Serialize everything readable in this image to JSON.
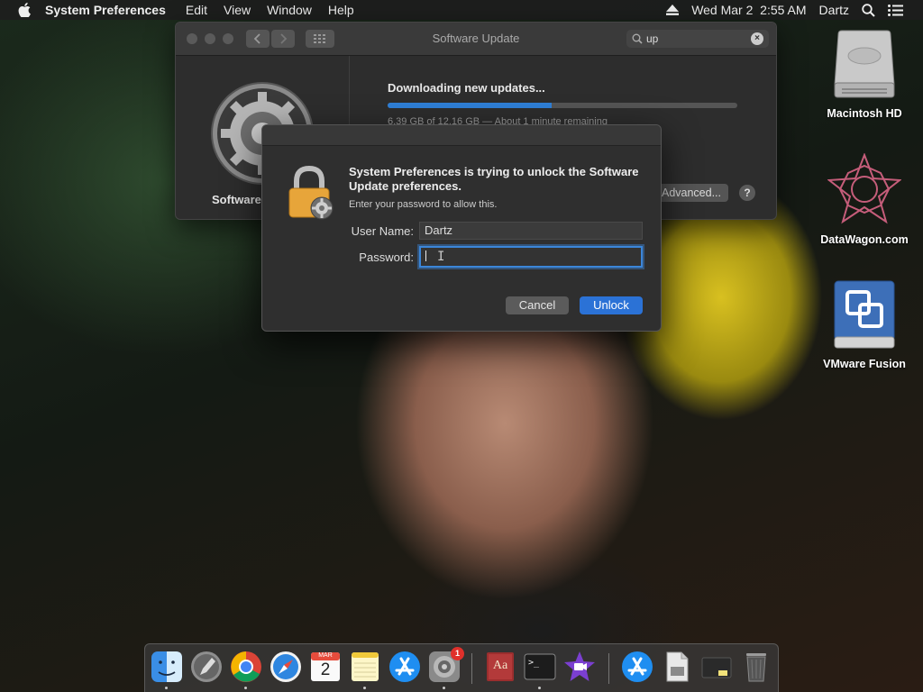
{
  "menubar": {
    "app_name": "System Preferences",
    "items": [
      "Edit",
      "View",
      "Window",
      "Help"
    ],
    "datetime": "Wed Mar 2  2:55 AM",
    "user": "Dartz"
  },
  "desktop": {
    "icons": [
      {
        "label": "Macintosh HD"
      },
      {
        "label": "DataWagon.com"
      },
      {
        "label": "VMware Fusion"
      }
    ]
  },
  "software_update": {
    "title": "Software Update",
    "search_value": "up",
    "sidebar_label": "Software",
    "download_title": "Downloading new updates...",
    "download_progress": 0.47,
    "download_status": "6.39 GB of 12.16 GB — About 1 minute remaining",
    "advanced_label": "Advanced...",
    "help_label": "?"
  },
  "auth_dialog": {
    "heading": "System Preferences is trying to unlock the Software Update preferences.",
    "subtext": "Enter your password to allow this.",
    "username_label": "User Name:",
    "username_value": "Dartz",
    "password_label": "Password:",
    "password_value": "",
    "cancel_label": "Cancel",
    "unlock_label": "Unlock"
  },
  "dock": {
    "items": [
      {
        "name": "Finder",
        "icon": "finder-icon"
      },
      {
        "name": "Launchpad",
        "icon": "launchpad-icon"
      },
      {
        "name": "Google Chrome",
        "icon": "chrome-icon"
      },
      {
        "name": "Safari",
        "icon": "safari-icon"
      },
      {
        "name": "Calendar",
        "icon": "calendar-icon",
        "month": "MAR",
        "day": "2"
      },
      {
        "name": "Notes",
        "icon": "notes-icon"
      },
      {
        "name": "App Store",
        "icon": "app-store-icon"
      },
      {
        "name": "System Preferences",
        "icon": "system-preferences-icon",
        "badge": "1"
      },
      {
        "name": "Dictionary",
        "icon": "dictionary-icon",
        "text": "Aa"
      },
      {
        "name": "Terminal",
        "icon": "terminal-icon",
        "text": ">_"
      },
      {
        "name": "iMovie",
        "icon": "imovie-icon"
      },
      {
        "name": "App Store Downloads",
        "icon": "downloads-icon"
      },
      {
        "name": "Document",
        "icon": "document-icon"
      },
      {
        "name": "Folder",
        "icon": "folder-icon"
      },
      {
        "name": "Trash",
        "icon": "trash-icon"
      }
    ]
  }
}
